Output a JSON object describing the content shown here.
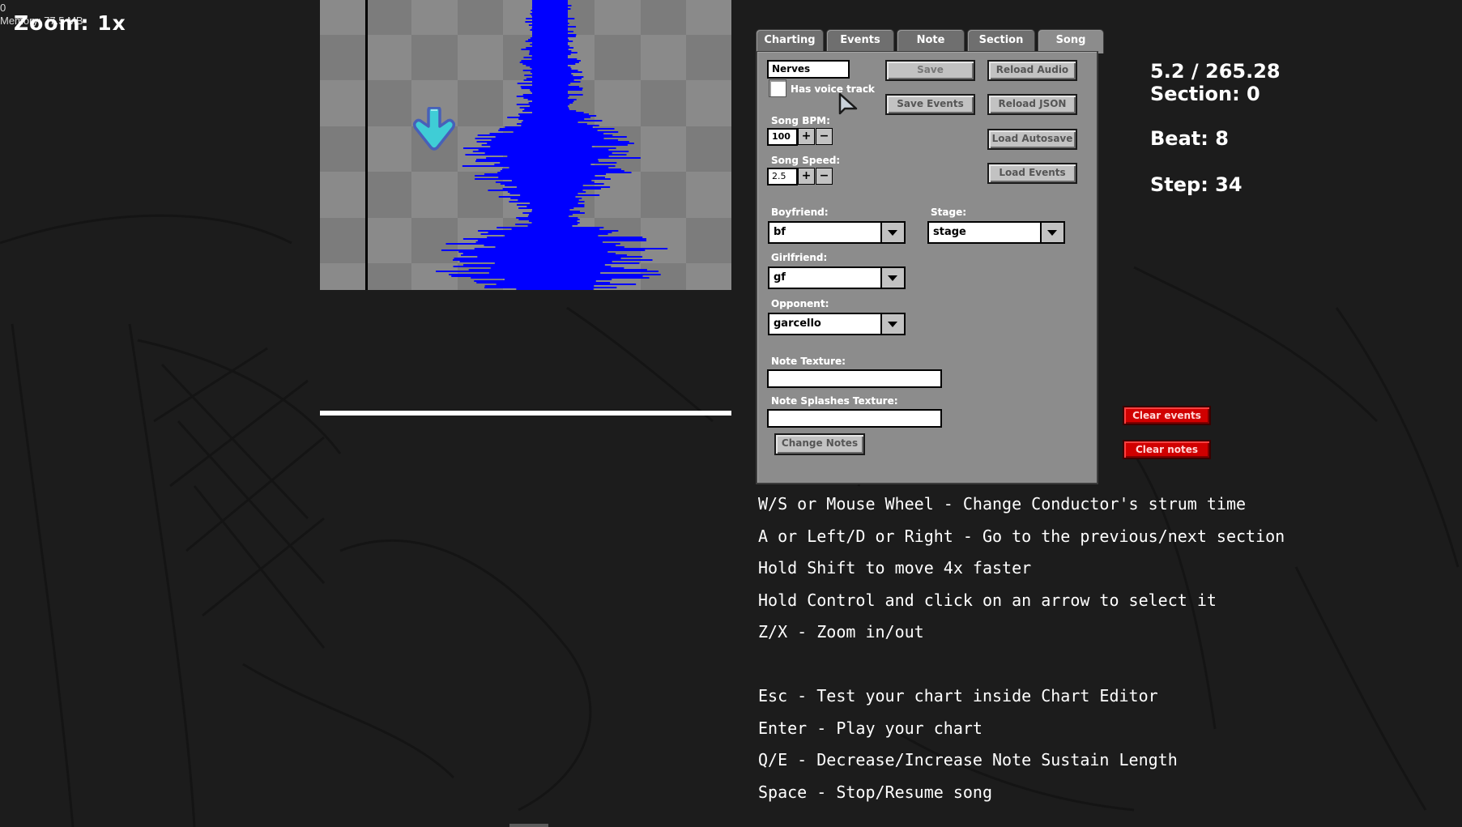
{
  "debug": {
    "fps": "0",
    "memory": "Memory: 77.5 MB"
  },
  "zoom_label": "Zoom: 1x",
  "chart_editor": {
    "note": {
      "icon": "down-arrow-note",
      "color": "#3fcdd6",
      "outline": "#4860b8"
    },
    "waveform_color": "#0000ff"
  },
  "tabs": [
    {
      "label": "Charting",
      "active": false
    },
    {
      "label": "Events",
      "active": false
    },
    {
      "label": "Note",
      "active": false
    },
    {
      "label": "Section",
      "active": false
    },
    {
      "label": "Song",
      "active": true
    }
  ],
  "song_tab": {
    "song_name": "Nerves",
    "has_voice_track_label": "Has voice track",
    "has_voice_track": false,
    "buttons": {
      "save": "Save",
      "reload_audio": "Reload Audio",
      "save_events": "Save Events",
      "reload_json": "Reload JSON",
      "load_autosave": "Load Autosave",
      "load_events": "Load Events",
      "change_notes": "Change Notes"
    },
    "bpm_label": "Song BPM:",
    "bpm_value": "100",
    "speed_label": "Song Speed:",
    "speed_value": "2.5",
    "plus": "+",
    "minus": "−",
    "boyfriend_label": "Boyfriend:",
    "boyfriend_value": "bf",
    "stage_label": "Stage:",
    "stage_value": "stage",
    "girlfriend_label": "Girlfriend:",
    "girlfriend_value": "gf",
    "opponent_label": "Opponent:",
    "opponent_value": "garcello",
    "note_texture_label": "Note Texture:",
    "note_texture_value": "",
    "note_splashes_label": "Note Splashes Texture:",
    "note_splashes_value": ""
  },
  "info": {
    "time": "5.2 / 265.28",
    "section": "Section: 0",
    "beat": "Beat: 8",
    "step": "Step: 34"
  },
  "actions": {
    "clear_events": "Clear events",
    "clear_notes": "Clear notes",
    "danger_color": "#d00000"
  },
  "help_lines": [
    "W/S or Mouse Wheel - Change Conductor's strum time",
    "A or Left/D or Right - Go to the previous/next section",
    "Hold Shift to move 4x faster",
    "Hold Control and click on an arrow to select it",
    "Z/X - Zoom in/out",
    "",
    "Esc - Test your chart inside Chart Editor",
    "Enter - Play your chart",
    "Q/E - Decrease/Increase Note Sustain Length",
    "Space - Stop/Resume song"
  ]
}
